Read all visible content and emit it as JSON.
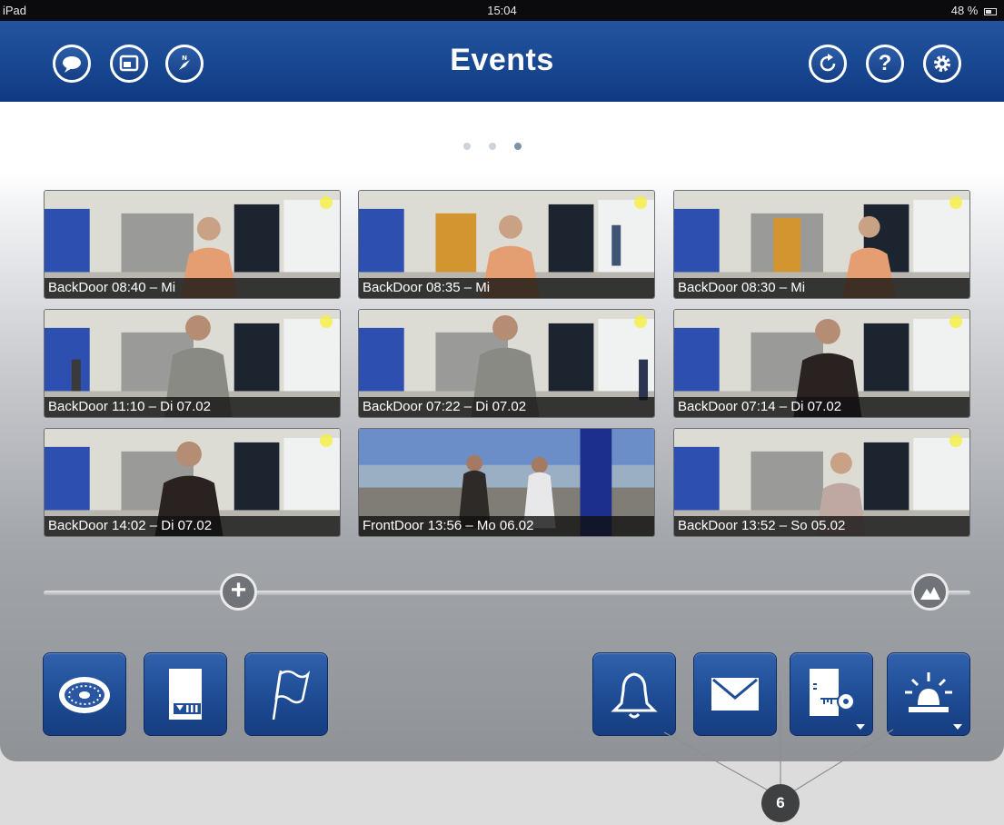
{
  "status_bar": {
    "device": "iPad",
    "time": "15:04",
    "battery": "48 %"
  },
  "header": {
    "title": "Events",
    "left_icons": [
      "speech-bubble-icon",
      "window-icon",
      "compass-icon"
    ],
    "right_icons": [
      "refresh-icon",
      "help-icon",
      "settings-gear-icon"
    ],
    "help_glyph": "?"
  },
  "pager": {
    "pages": 3,
    "active_page": 3
  },
  "events": [
    {
      "label": "BackDoor 08:40 – Mi"
    },
    {
      "label": "BackDoor 08:35 – Mi"
    },
    {
      "label": "BackDoor 08:30 – Mi"
    },
    {
      "label": "BackDoor 11:10 – Di 07.02"
    },
    {
      "label": "BackDoor 07:22 – Di 07.02"
    },
    {
      "label": "BackDoor 07:14 – Di 07.02"
    },
    {
      "label": "BackDoor 14:02 – Di 07.02"
    },
    {
      "label": "FrontDoor 13:56 – Mo 06.02"
    },
    {
      "label": "BackDoor 13:52 – So 05.02"
    }
  ],
  "slider": {
    "left_glyph": "+",
    "right_icon": "mountains-icon"
  },
  "toolbar_left": [
    "camera-dome-icon",
    "sd-card-icon",
    "flag-icon"
  ],
  "toolbar_right": [
    "bell-icon",
    "mail-icon",
    "door-key-icon",
    "alarm-siren-icon"
  ],
  "callout": {
    "number": "6"
  },
  "colors": {
    "navbar": "#184791",
    "button": "#1f4d96",
    "accent_dot": "#f4ee4a"
  }
}
